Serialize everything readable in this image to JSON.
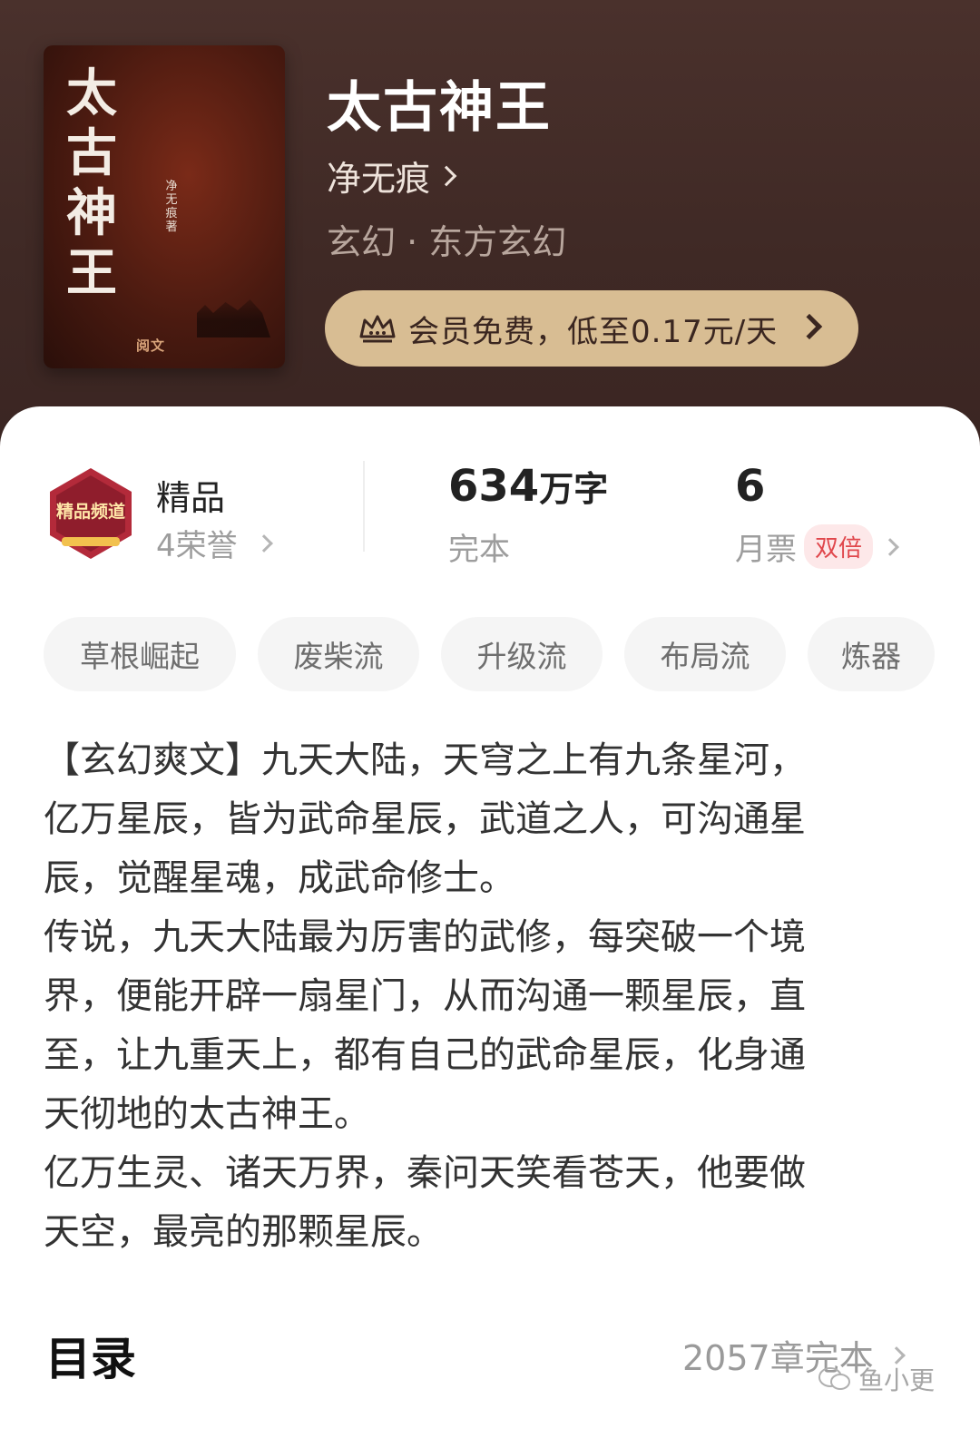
{
  "colors": {
    "header_bg": "#3f2925",
    "vip_bg": "#d8bd93",
    "badge_red": "#b32a3a",
    "double_red": "#e0474c"
  },
  "cover": {
    "title": "太古神王",
    "author": "净无痕 著",
    "publisher": "阅文"
  },
  "book": {
    "title": "太古神王",
    "author": "净无痕",
    "genre": "玄幻 · 东方玄幻",
    "vip_text": "会员免费，低至0.17元/天"
  },
  "stats": {
    "badge_text": "精品频道",
    "quality_label": "精品",
    "honors": "4荣誉",
    "word_count": "634",
    "word_unit": "万字",
    "status": "完本",
    "monthly_tickets": "6",
    "monthly_label": "月票",
    "double_label": "双倍"
  },
  "tags": [
    "草根崛起",
    "废柴流",
    "升级流",
    "布局流",
    "炼器"
  ],
  "description": "【玄幻爽文】九天大陆，天穹之上有九条星河，\n亿万星辰，皆为武命星辰，武道之人，可沟通星\n辰，觉醒星魂，成武命修士。\n传说，九天大陆最为厉害的武修，每突破一个境\n界，便能开辟一扇星门，从而沟通一颗星辰，直\n至，让九重天上，都有自己的武命星辰，化身通\n天彻地的太古神王。\n亿万生灵、诸天万界，秦问天笑看苍天，他要做\n天空，最亮的那颗星辰。",
  "toc": {
    "title": "目录",
    "count": "2057章完本"
  },
  "watermark": "鱼小更",
  "icons": [
    "crown-icon",
    "chevron-right-icon",
    "wechat-icon"
  ]
}
